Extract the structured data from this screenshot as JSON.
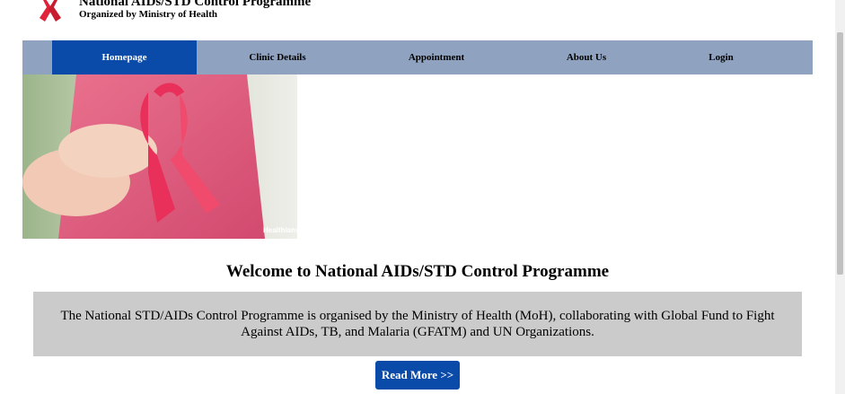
{
  "header": {
    "title": "National AIDs/STD Control Programme",
    "subtitle": "Organized by Ministry of Health",
    "logo_icon": "red-ribbon-icon"
  },
  "nav": {
    "items": [
      {
        "label": "Homepage",
        "active": true
      },
      {
        "label": "Clinic Details",
        "active": false
      },
      {
        "label": "Appointment",
        "active": false
      },
      {
        "label": "About Us",
        "active": false
      },
      {
        "label": "Login",
        "active": false
      }
    ]
  },
  "hero": {
    "watermark": "Healthians"
  },
  "main": {
    "welcome_heading": "Welcome to National AIDs/STD Control Programme",
    "intro_text": "The National STD/AIDs Control Programme is organised by the Ministry of Health (MoH), collaborating with Global Fund to Fight Against AIDs, TB, and Malaria (GFATM) and UN Organizations.",
    "read_more_label": "Read More >>"
  },
  "colors": {
    "nav_background": "#8fa3c1",
    "nav_active": "#0a4aa8",
    "button": "#0a4aa8",
    "intro_box": "#cbcbcb",
    "ribbon": "#e0233a"
  }
}
